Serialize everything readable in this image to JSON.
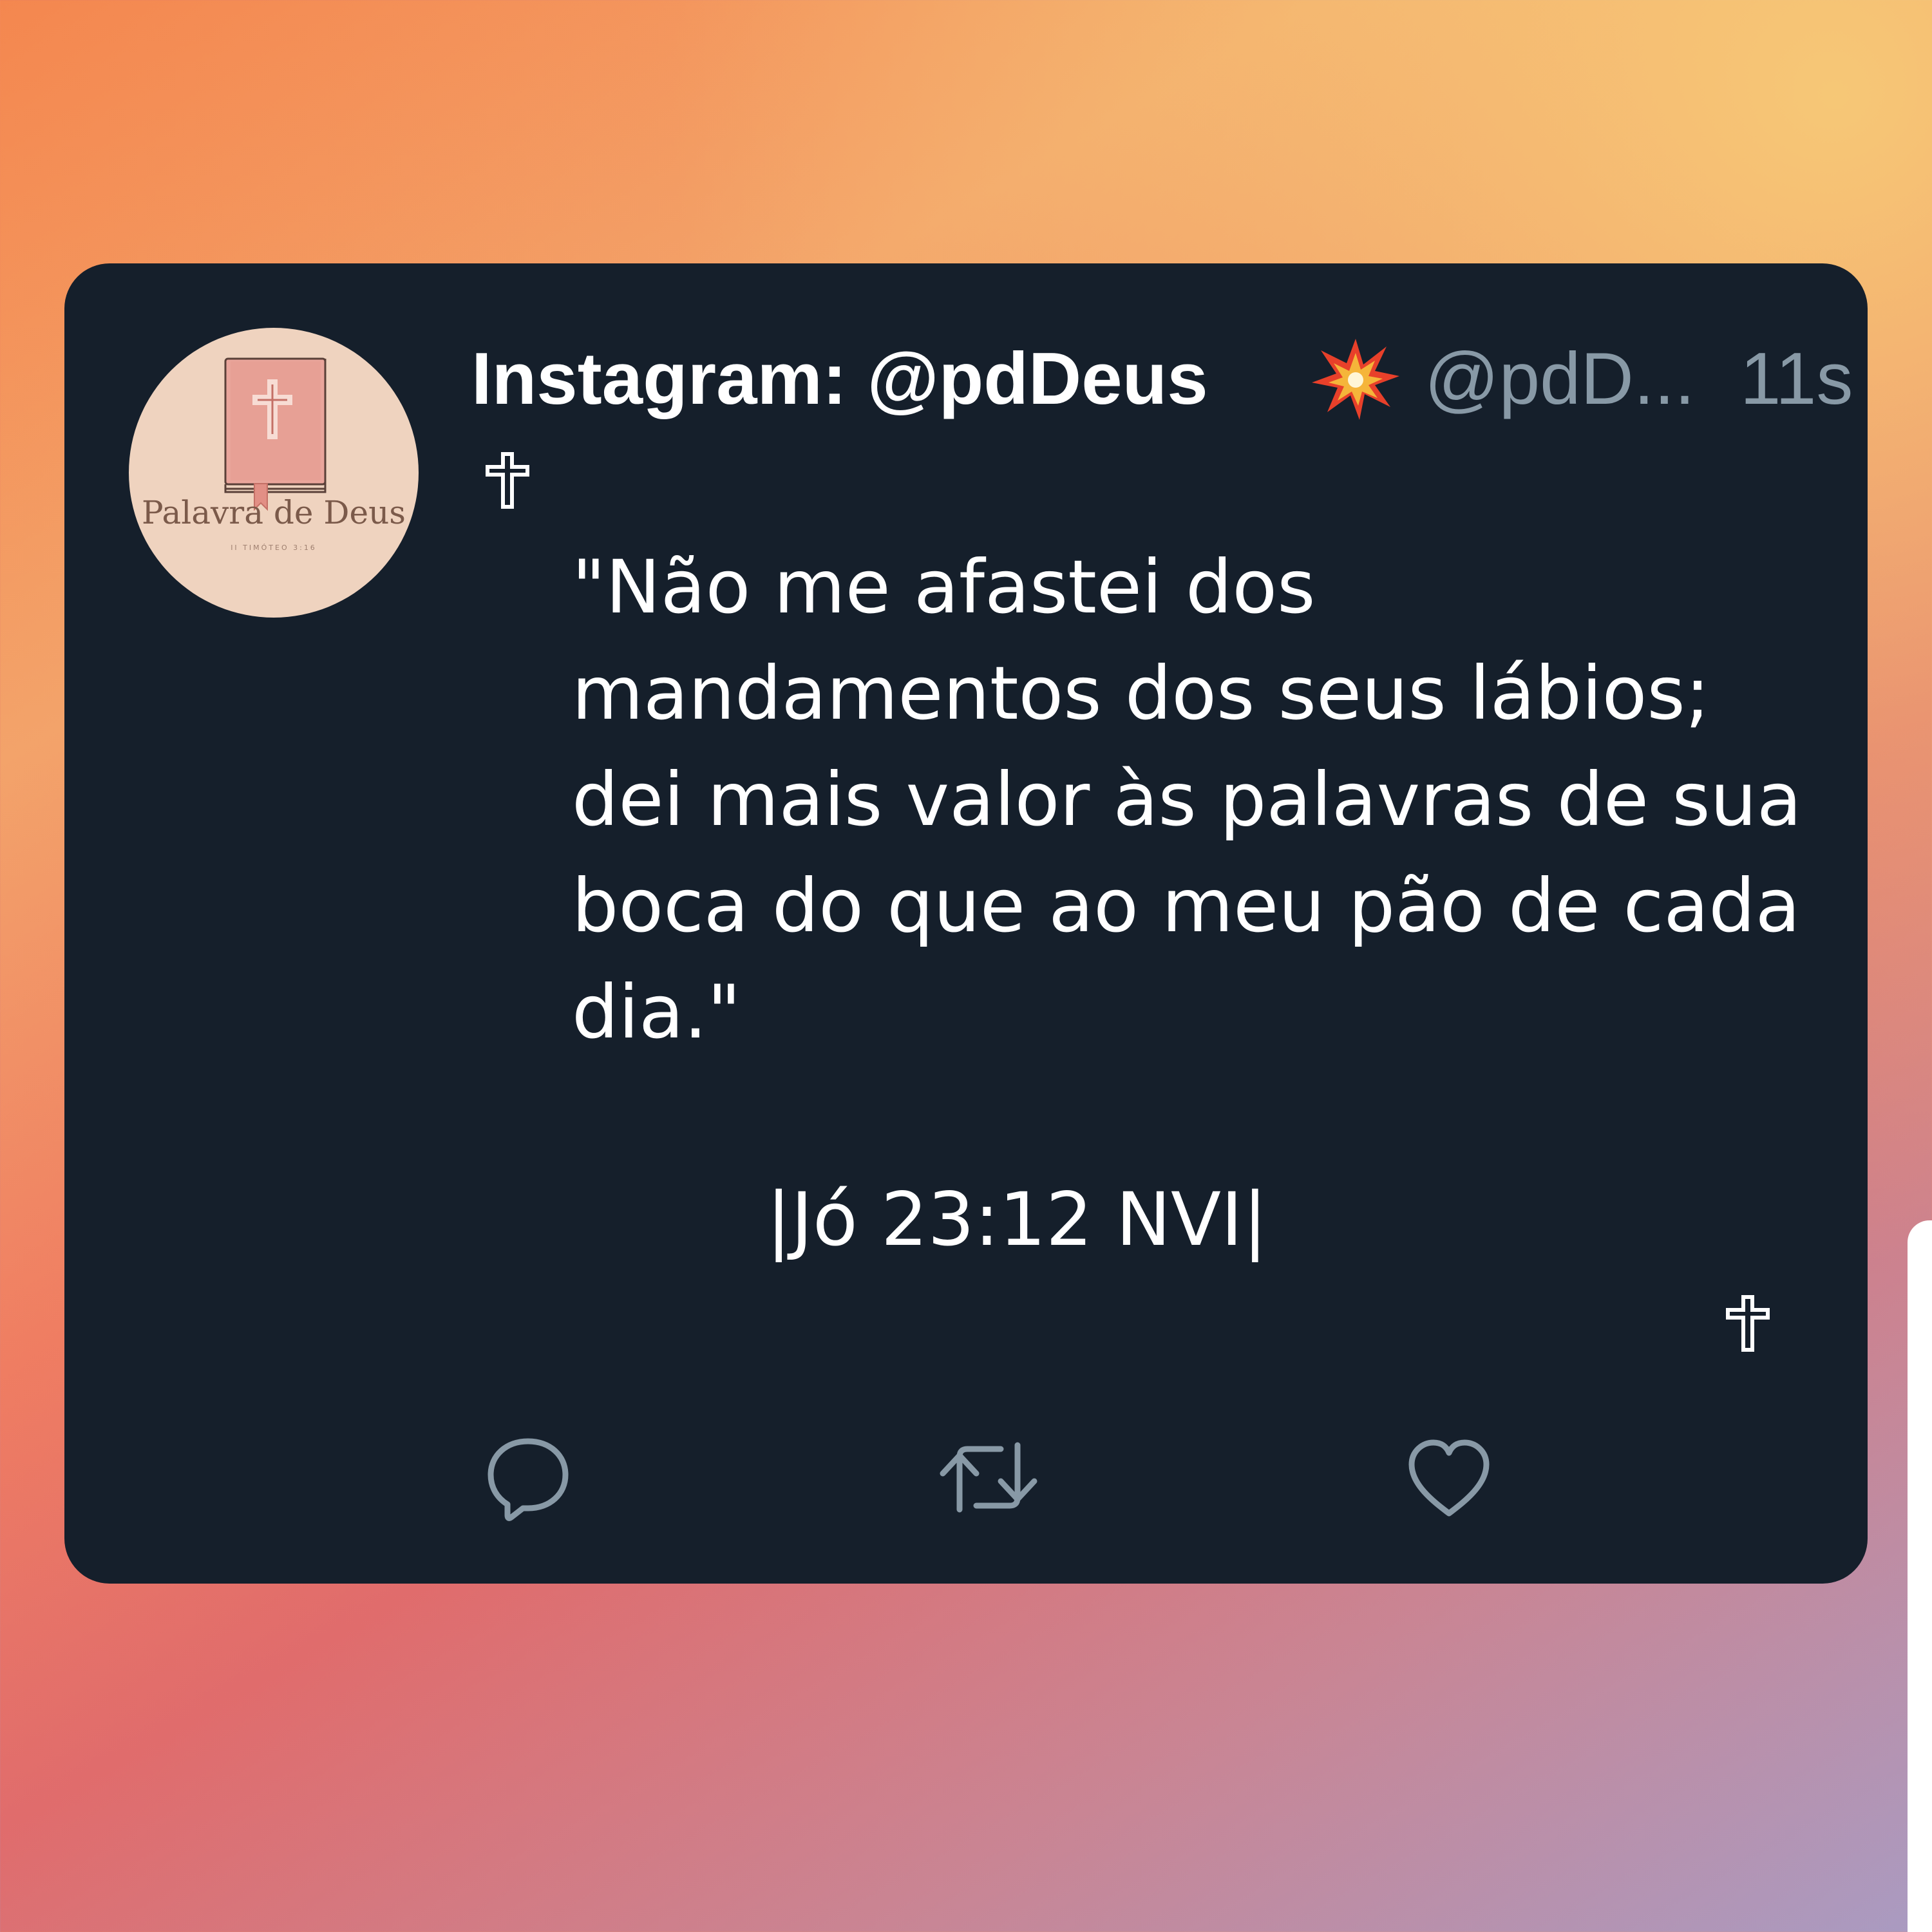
{
  "tweet": {
    "avatar": {
      "logo_title": "Palavra de Deus",
      "logo_subtitle": "II TIMÓTEO 3:16",
      "background_color": "#efd3bf"
    },
    "display_name": "Instagram: @pdDeus",
    "display_name_emoji": "collision-icon",
    "handle": "@pdD...",
    "timestamp": "11s",
    "cross_symbol": "✞",
    "text": "\"Não me afastei dos\nmandamentos dos seus lábios;\ndei mais valor às palavras de sua\nboca do que ao meu pão de cada\ndia.\"",
    "reference": "|Jó 23:12 NVI|",
    "actions": {
      "reply_icon": "reply-icon",
      "retweet_icon": "retweet-icon",
      "like_icon": "heart-icon"
    },
    "colors": {
      "card_background": "#151f2b",
      "primary_text": "#ffffff",
      "secondary_text": "#8899a6"
    }
  }
}
